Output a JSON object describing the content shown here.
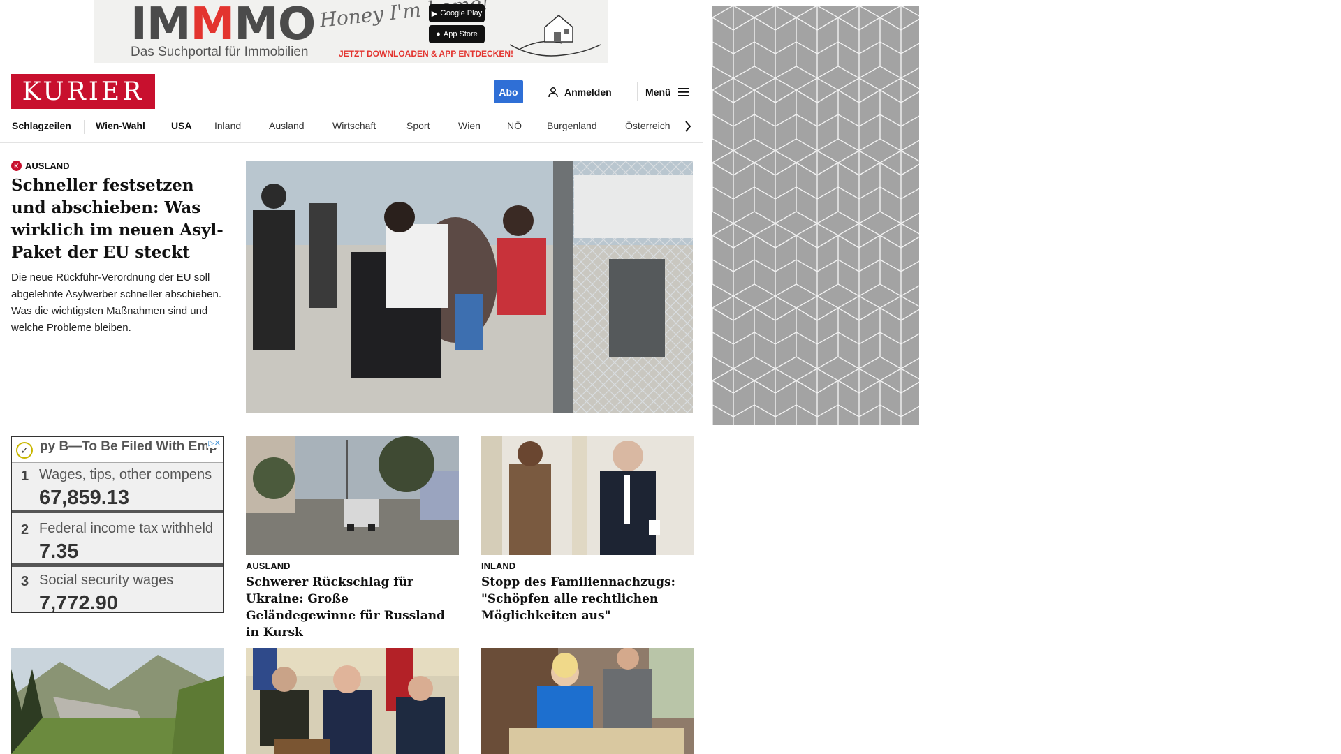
{
  "top_ad": {
    "brand_pre": "IM",
    "brand_accent": "M",
    "brand_post": "MO",
    "tagline": "Das Suchportal für Immobilien",
    "script_text": "Honey I'm home!",
    "google_play": "Google Play",
    "app_store": "App Store",
    "cta": "JETZT DOWNLOADEN & APP ENTDECKEN!"
  },
  "header": {
    "logo": "KURIER",
    "abo": "Abo",
    "login": "Anmelden",
    "menu": "Menü"
  },
  "nav": {
    "items": [
      "Schlagzeilen",
      "Wien-Wahl",
      "USA",
      "Inland",
      "Ausland",
      "Wirtschaft",
      "Sport",
      "Wien",
      "NÖ",
      "Burgenland",
      "Österreich"
    ]
  },
  "lead": {
    "category": "AUSLAND",
    "title": "Schneller festsetzen und abschieben: Was wirklich im neuen Asyl-Paket der EU steckt",
    "teaser": "Die neue Rückführ-Verordnung der EU soll abgelehnte Asylwerber schneller abschieben. Was die wichtigsten Maßnahmen sind und welche Probleme bleiben."
  },
  "w2_ad": {
    "header": "py B—To Be Filed With Emp",
    "rows": [
      {
        "num": "1",
        "label": "Wages, tips, other compens",
        "value": "67,859.13"
      },
      {
        "num": "2",
        "label": "Federal income tax withheld",
        "value": "7.35"
      },
      {
        "num": "3",
        "label": "Social security wages",
        "value": "7,772.90"
      }
    ]
  },
  "cards": [
    {
      "category": "AUSLAND",
      "title": "Schwerer Rückschlag für Ukraine: Große Geländegewinne für Russland in Kursk"
    },
    {
      "category": "INLAND",
      "title": "Stopp des Familiennachzugs: \"Schöpfen alle rechtlichen Möglichkeiten aus\""
    }
  ],
  "colors": {
    "brand_red": "#c8102e",
    "abo_blue": "#2f6fd6",
    "pattern_gray": "#a3a3a3"
  }
}
